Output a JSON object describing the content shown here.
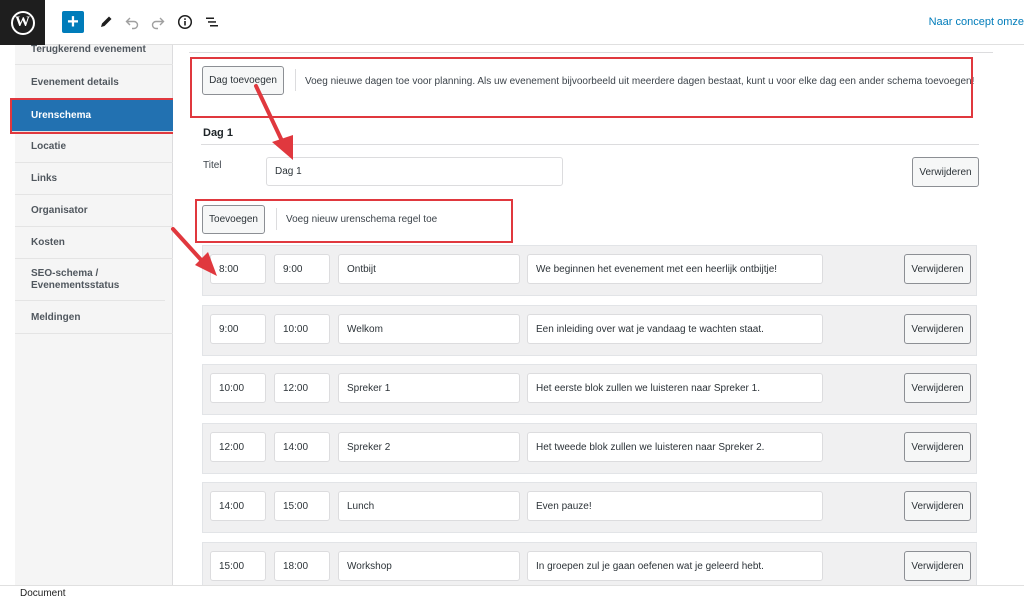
{
  "toolbar": {
    "logo_letter": "W",
    "add_icon": "plus-icon",
    "edit_icon": "pencil-icon",
    "undo_icon": "undo-icon",
    "redo_icon": "redo-icon",
    "info_icon": "info-icon",
    "outline_icon": "list-view-icon",
    "draft_link": "Naar concept omze"
  },
  "sidebar": {
    "items": [
      {
        "label": "Terugkerend evenement"
      },
      {
        "label": "Evenement details"
      },
      {
        "label": "Urenschema",
        "active": true
      },
      {
        "label": "Locatie"
      },
      {
        "label": "Links"
      },
      {
        "label": "Organisator"
      },
      {
        "label": "Kosten"
      },
      {
        "label": "SEO-schema / Evenementsstatus"
      },
      {
        "label": "Meldingen"
      }
    ]
  },
  "main": {
    "add_day_button": "Dag toevoegen",
    "add_day_desc": "Voeg nieuwe dagen toe voor planning. Als uw evenement bijvoorbeeld uit meerdere dagen bestaat, kunt u voor elke dag een ander schema toevoegen!",
    "day_heading": "Dag 1",
    "title_label": "Titel",
    "title_value": "Dag 1",
    "remove_day_button": "Verwijderen",
    "add_row_button": "Toevoegen",
    "add_row_desc": "Voeg nieuw urenschema regel toe",
    "rows": [
      {
        "start": "8:00",
        "end": "9:00",
        "title": "Ontbijt",
        "desc": "We beginnen het evenement met een heerlijk ontbijtje!",
        "remove": "Verwijderen"
      },
      {
        "start": "9:00",
        "end": "10:00",
        "title": "Welkom",
        "desc": "Een inleiding over wat je vandaag te wachten staat.",
        "remove": "Verwijderen"
      },
      {
        "start": "10:00",
        "end": "12:00",
        "title": "Spreker 1",
        "desc": "Het eerste blok zullen we luisteren naar Spreker 1.",
        "remove": "Verwijderen"
      },
      {
        "start": "12:00",
        "end": "14:00",
        "title": "Spreker 2",
        "desc": "Het tweede blok zullen we luisteren naar Spreker 2.",
        "remove": "Verwijderen"
      },
      {
        "start": "14:00",
        "end": "15:00",
        "title": "Lunch",
        "desc": "Even pauze!",
        "remove": "Verwijderen"
      },
      {
        "start": "15:00",
        "end": "18:00",
        "title": "Workshop",
        "desc": "In groepen zul je gaan oefenen wat je geleerd hebt.",
        "remove": "Verwijderen"
      }
    ]
  },
  "statusbar": {
    "label": "Document"
  },
  "colors": {
    "accent": "#007cba",
    "active_tab": "#2271b1",
    "highlight": "#e0383e"
  }
}
